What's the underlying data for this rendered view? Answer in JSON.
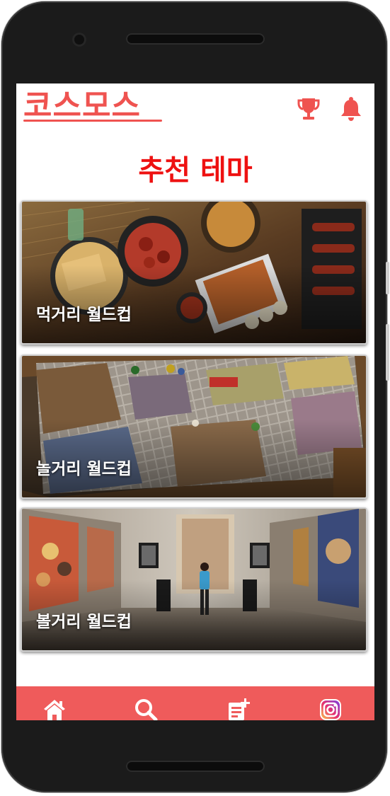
{
  "app": {
    "title": "코스모스",
    "brand_color": "#ef5350"
  },
  "header": {
    "icons": [
      "trophy-icon",
      "bell-icon"
    ]
  },
  "section": {
    "title": "추천 테마",
    "title_color": "#ee1111"
  },
  "cards": [
    {
      "label": "먹거리 월드컵",
      "image": "food-spread-photo"
    },
    {
      "label": "놀거리 월드컵",
      "image": "board-game-photo"
    },
    {
      "label": "볼거리 월드컵",
      "image": "art-gallery-photo"
    }
  ],
  "bottom_nav": {
    "color": "#ef5b5b",
    "items": [
      "home-icon",
      "search-icon",
      "add-post-icon",
      "instagram-icon"
    ]
  }
}
